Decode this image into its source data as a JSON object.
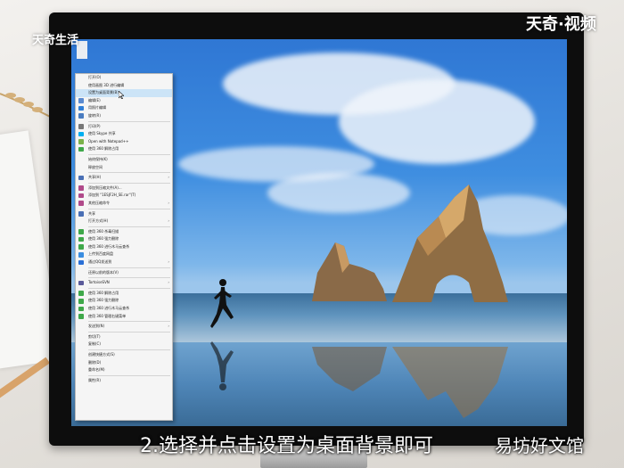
{
  "brand": {
    "left_logo": "天奇生活",
    "right_logo": "天奇·视频"
  },
  "caption": "2.选择并点击设置为桌面背景即可",
  "watermark": "易坊好文馆",
  "context_menu": {
    "items": [
      {
        "label": "打开(O)",
        "icon": "none"
      },
      {
        "label": "使用画图 3D 进行编辑",
        "icon": "none"
      },
      {
        "label": "设置为桌面背景(B)",
        "icon": "none",
        "highlighted": true
      },
      {
        "label": "编辑(E)",
        "icon": "edit-icon"
      },
      {
        "label": "用照片编辑",
        "icon": "photos-icon"
      },
      {
        "label": "旋转(R)",
        "icon": "rotate-icon"
      },
      {
        "label": "",
        "separator": true
      },
      {
        "label": "打印(P)",
        "icon": "print-icon"
      },
      {
        "label": "使用 Skype 共享",
        "icon": "skype-icon"
      },
      {
        "label": "Open with Notepad++",
        "icon": "notepad-icon"
      },
      {
        "label": "使用 360 解除占用",
        "icon": "shield-icon"
      },
      {
        "label": "",
        "separator": true
      },
      {
        "label": "始终保持(K)",
        "icon": "none"
      },
      {
        "label": "释放空间",
        "icon": "none"
      },
      {
        "label": "",
        "separator": true
      },
      {
        "label": "共享(H)",
        "icon": "share-icon",
        "submenu": true
      },
      {
        "label": "",
        "separator": true
      },
      {
        "label": "添加到压缩文件(A)...",
        "icon": "archive-icon"
      },
      {
        "label": "添加到 \"1ESJF2H_SE.rar\"(T)",
        "icon": "archive-icon"
      },
      {
        "label": "其他压缩命令",
        "icon": "archive-icon",
        "submenu": true
      },
      {
        "label": "",
        "separator": true
      },
      {
        "label": "共享",
        "icon": "share-icon"
      },
      {
        "label": "打开方式(H)",
        "icon": "none",
        "submenu": true
      },
      {
        "label": "",
        "separator": true
      },
      {
        "label": "使用 360 杀毒扫描",
        "icon": "shield-icon"
      },
      {
        "label": "使用 360 强力删除",
        "icon": "shield-icon"
      },
      {
        "label": "使用 360 进行木马云查杀",
        "icon": "shield-icon"
      },
      {
        "label": "上传到百度网盘",
        "icon": "cloud-icon"
      },
      {
        "label": "通过QQ发送到",
        "icon": "qq-icon",
        "submenu": true
      },
      {
        "label": "",
        "separator": true
      },
      {
        "label": "还原以前的版本(V)",
        "icon": "none"
      },
      {
        "label": "",
        "separator": true
      },
      {
        "label": "TortoiseSVN",
        "icon": "svn-icon",
        "submenu": true
      },
      {
        "label": "",
        "separator": true
      },
      {
        "label": "使用 360 解除占用",
        "icon": "shield-icon"
      },
      {
        "label": "使用 360 强力删除",
        "icon": "shield-icon"
      },
      {
        "label": "使用 360 进行木马云查杀",
        "icon": "shield-icon"
      },
      {
        "label": "使用 360 管理右键菜单",
        "icon": "shield-icon"
      },
      {
        "label": "",
        "separator": true
      },
      {
        "label": "发送到(N)",
        "icon": "none",
        "submenu": true
      },
      {
        "label": "",
        "separator": true
      },
      {
        "label": "剪切(T)",
        "icon": "none"
      },
      {
        "label": "复制(C)",
        "icon": "none"
      },
      {
        "label": "",
        "separator": true
      },
      {
        "label": "创建快捷方式(S)",
        "icon": "none"
      },
      {
        "label": "删除(D)",
        "icon": "none"
      },
      {
        "label": "重命名(M)",
        "icon": "none"
      },
      {
        "label": "",
        "separator": true
      },
      {
        "label": "属性(R)",
        "icon": "none"
      }
    ]
  },
  "colors": {
    "menu_highlight": "#cce4f7",
    "sky_top": "#2f77d4",
    "monitor_bezel": "#0d0d0d"
  }
}
